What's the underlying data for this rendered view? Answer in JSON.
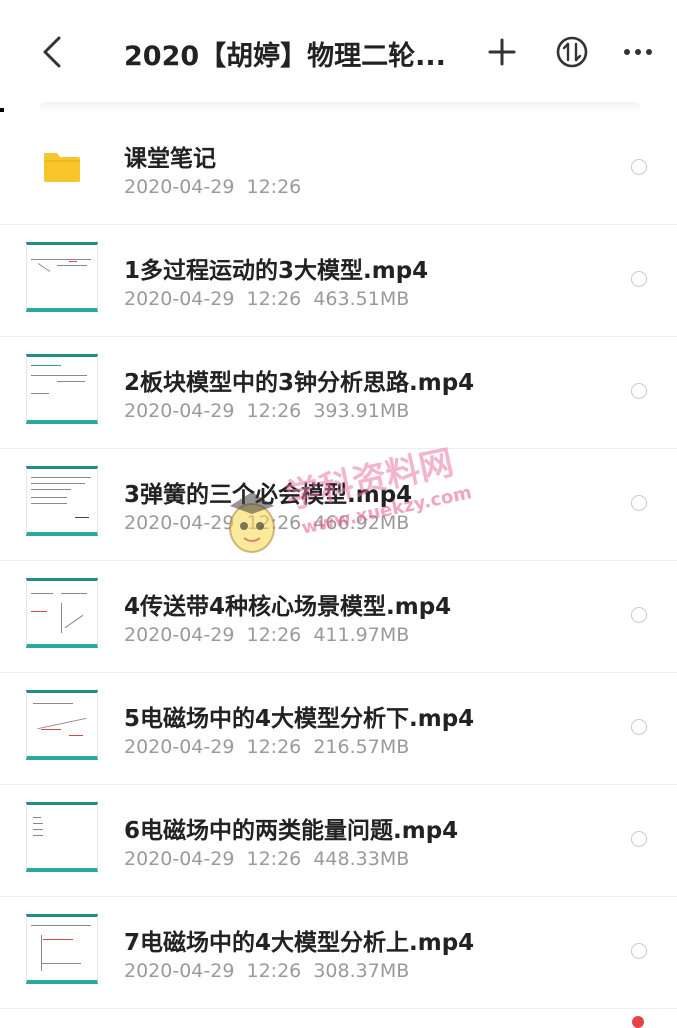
{
  "header": {
    "title": "2020【胡婷】物理二轮...",
    "back_icon": "back-arrow-icon",
    "add_icon": "plus-icon",
    "sort_icon": "sort-icon",
    "more_icon": "more-icon"
  },
  "items": [
    {
      "name": "课堂笔记",
      "meta": "2020-04-29  12:26",
      "type": "folder"
    },
    {
      "name": "1多过程运动的3大模型.mp4",
      "meta": "2020-04-29  12:26  463.51MB",
      "type": "video"
    },
    {
      "name": "2板块模型中的3钟分析思路.mp4",
      "meta": "2020-04-29  12:26  393.91MB",
      "type": "video"
    },
    {
      "name": "3弹簧的三个必会模型.mp4",
      "meta": "2020-04-29  12:26  466.92MB",
      "type": "video"
    },
    {
      "name": "4传送带4种核心场景模型.mp4",
      "meta": "2020-04-29  12:26  411.97MB",
      "type": "video"
    },
    {
      "name": "5电磁场中的4大模型分析下.mp4",
      "meta": "2020-04-29  12:26  216.57MB",
      "type": "video"
    },
    {
      "name": "6电磁场中的两类能量问题.mp4",
      "meta": "2020-04-29  12:26  448.33MB",
      "type": "video"
    },
    {
      "name": "7电磁场中的4大模型分析上.mp4",
      "meta": "2020-04-29  12:26  308.37MB",
      "type": "video"
    }
  ],
  "watermark": {
    "line1": "学科资料网",
    "line2": "www.xuekzy.com"
  },
  "colors": {
    "folder": "#f7c52c",
    "thumb_accent": "#28a9a6",
    "notification": "#e84343"
  }
}
